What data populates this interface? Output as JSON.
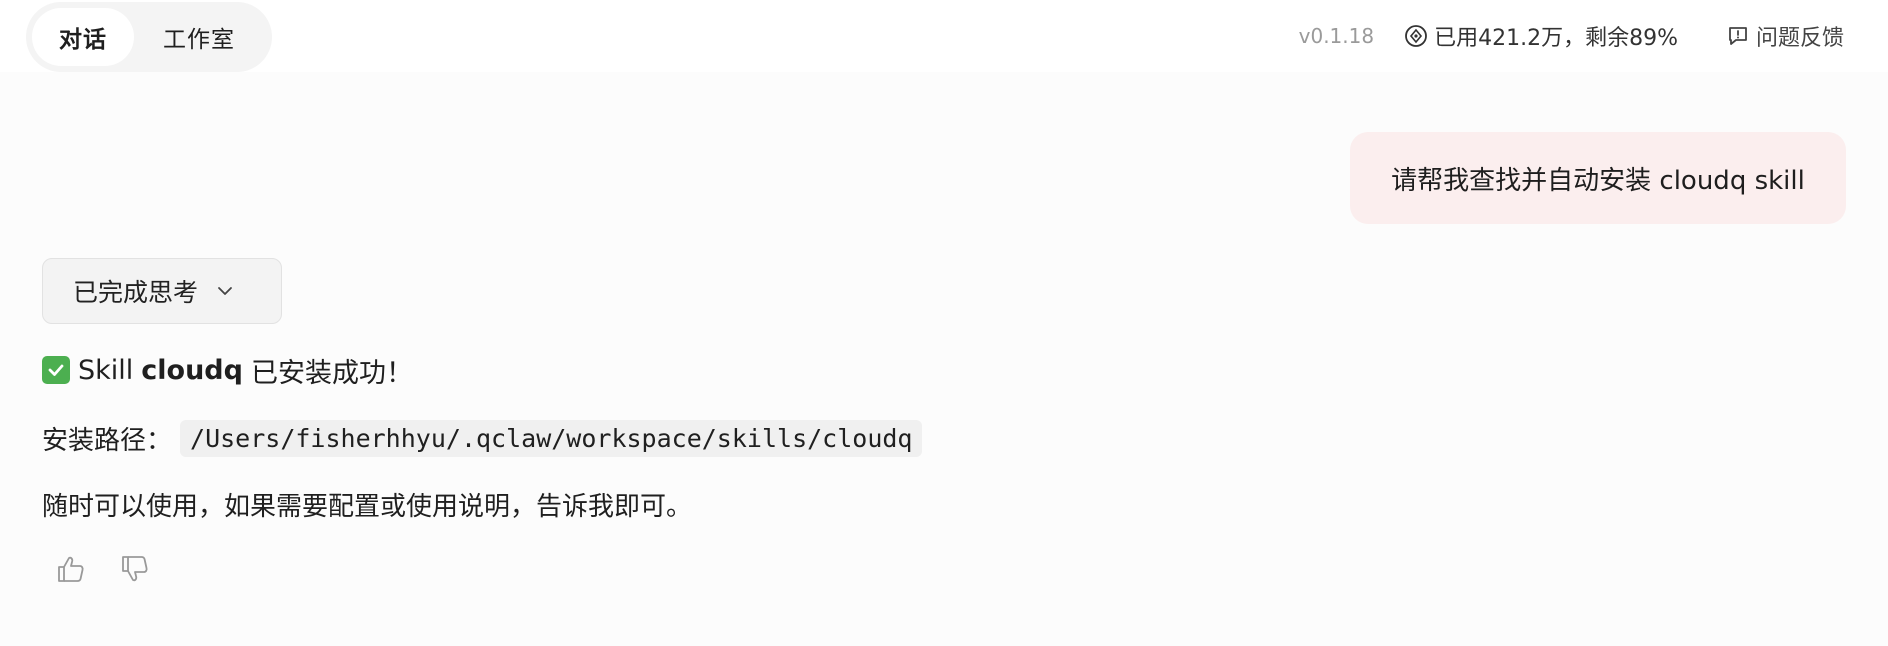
{
  "tabs": [
    {
      "label": "对话",
      "active": true
    },
    {
      "label": "工作室",
      "active": false
    }
  ],
  "header": {
    "version": "v0.1.18",
    "usage": "已用421.2万，剩余89%",
    "feedback": "问题反馈"
  },
  "icons": {
    "usage": "quota-icon",
    "feedback": "feedback-icon",
    "think_toggle": "chevron-down-icon",
    "success": "check-mark-icon",
    "like": "thumbs-up-icon",
    "dislike": "thumbs-down-icon"
  },
  "colors": {
    "user_bubble": "#fbeeee",
    "check_green": "#4caf50",
    "code_bg": "#f0f0f0"
  },
  "chat": {
    "user_message": "请帮我查找并自动安装 cloudq skill",
    "assistant": {
      "think_label": "已完成思考",
      "line1_prefix": "Skill",
      "line1_bold": "cloudq",
      "line1_suffix": "已安装成功！",
      "path_label": "安装路径：",
      "path_value": "/Users/fisherhhyu/.qclaw/workspace/skills/cloudq",
      "closing": "随时可以使用，如果需要配置或使用说明，告诉我即可。"
    }
  }
}
